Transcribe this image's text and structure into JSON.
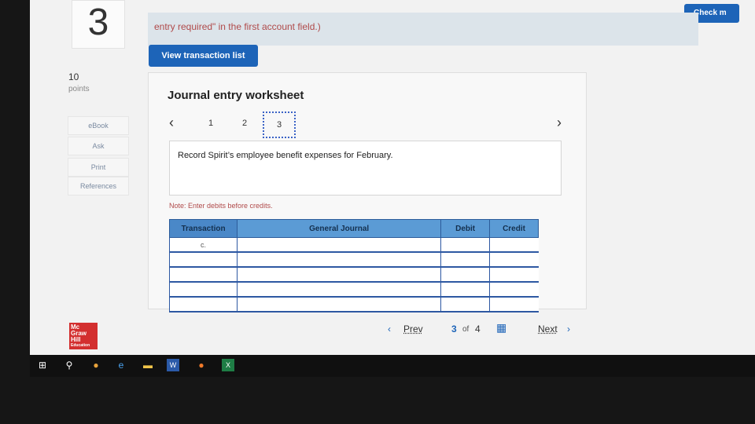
{
  "question": {
    "number": "3",
    "points": "10",
    "points_label": "points"
  },
  "banner": {
    "text": "entry required\" in the first account field.)"
  },
  "header": {
    "check_label": "Check m"
  },
  "actions": {
    "view_transactions": "View transaction list"
  },
  "sidebar": {
    "items": [
      {
        "label": "eBook"
      },
      {
        "label": "Ask"
      },
      {
        "label": "Print"
      },
      {
        "label": "References"
      }
    ]
  },
  "worksheet": {
    "title": "Journal entry worksheet",
    "steps": [
      "1",
      "2",
      "3"
    ],
    "prompt": "Record Spirit’s employee benefit expenses for February.",
    "note": "Note: Enter debits before credits."
  },
  "journal": {
    "headers": [
      "Transaction",
      "General Journal",
      "Debit",
      "Credit"
    ],
    "rows": [
      {
        "transaction": "c.",
        "account": "",
        "debit": "",
        "credit": ""
      },
      {
        "transaction": "",
        "account": "",
        "debit": "",
        "credit": ""
      },
      {
        "transaction": "",
        "account": "",
        "debit": "",
        "credit": ""
      },
      {
        "transaction": "",
        "account": "",
        "debit": "",
        "credit": ""
      },
      {
        "transaction": "",
        "account": "",
        "debit": "",
        "credit": ""
      }
    ]
  },
  "pager": {
    "prev": "Prev",
    "current": "3",
    "of": "of",
    "total": "4",
    "next": "Next"
  },
  "logo": {
    "line1": "Mc",
    "line2": "Graw",
    "line3": "Hill",
    "line4": "Education"
  },
  "taskbar_icons": [
    "windows-icon",
    "search-icon",
    "chrome-icon",
    "edge-icon",
    "explorer-icon",
    "word-icon",
    "firefox-icon",
    "excel-icon"
  ]
}
